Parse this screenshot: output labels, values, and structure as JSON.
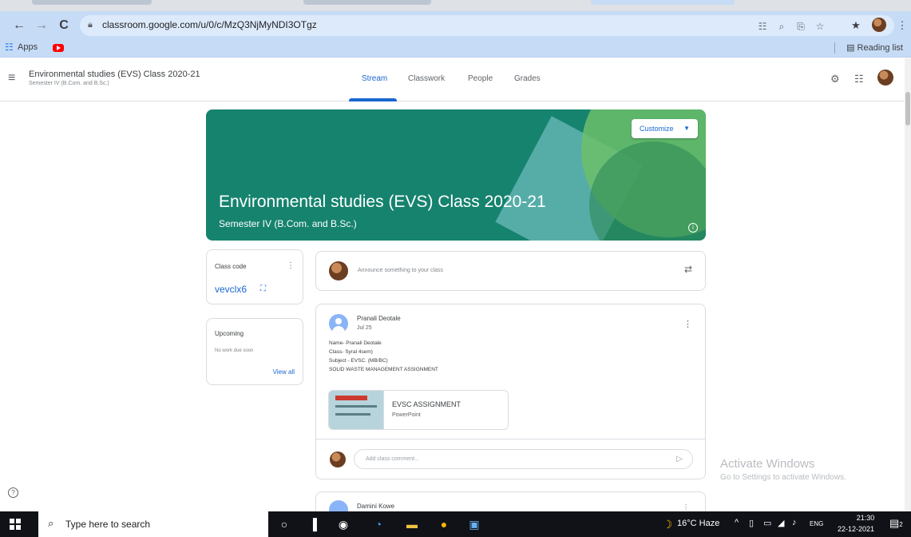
{
  "browser": {
    "url": "classroom.google.com/u/0/c/MzQ3NjMyNDI3OTgz",
    "bookmarks_apps": "Apps",
    "reading_list": "Reading list"
  },
  "header": {
    "class_title": "Environmental studies (EVS) Class 2020-21",
    "class_subtitle": "Semester IV (B.Com. and B.Sc.)",
    "tabs": [
      {
        "label": "Stream"
      },
      {
        "label": "Classwork"
      },
      {
        "label": "People"
      },
      {
        "label": "Grades"
      }
    ]
  },
  "banner": {
    "title": "Environmental studies (EVS) Class 2020-21",
    "subtitle": "Semester IV (B.Com. and B.Sc.)",
    "customize_label": "Customize",
    "color": "#16836e"
  },
  "class_code": {
    "label": "Class code",
    "value": "vevclx6"
  },
  "upcoming": {
    "label": "Upcoming",
    "empty_text": "No work due soon",
    "view_all": "View all"
  },
  "announce": {
    "placeholder": "Announce something to your class"
  },
  "post": {
    "author": "Pranali Deotale",
    "date": "Jul 25",
    "lines": [
      "Name- Pranali Deotale",
      "Class- Syral 4sem)",
      "Subject - EVSC. (MB/BC)",
      "SOLID WASTE MANAGEMENT ASSIGNMENT"
    ],
    "attachment_title": "EVSC ASSIGNMENT",
    "attachment_type": "PowerPoint",
    "comment_placeholder": "Add class comment..."
  },
  "next_post": {
    "author": "Damini Kowe"
  },
  "watermark": {
    "title": "Activate Windows",
    "subtitle": "Go to Settings to activate Windows."
  },
  "taskbar": {
    "search_placeholder": "Type here to search",
    "weather": "16°C Haze",
    "language": "ENG",
    "time": "21:30",
    "date": "22-12-2021",
    "notification_count": "2"
  },
  "colors": {
    "accent": "#1967d2",
    "chrome": "#c6dbf6"
  }
}
